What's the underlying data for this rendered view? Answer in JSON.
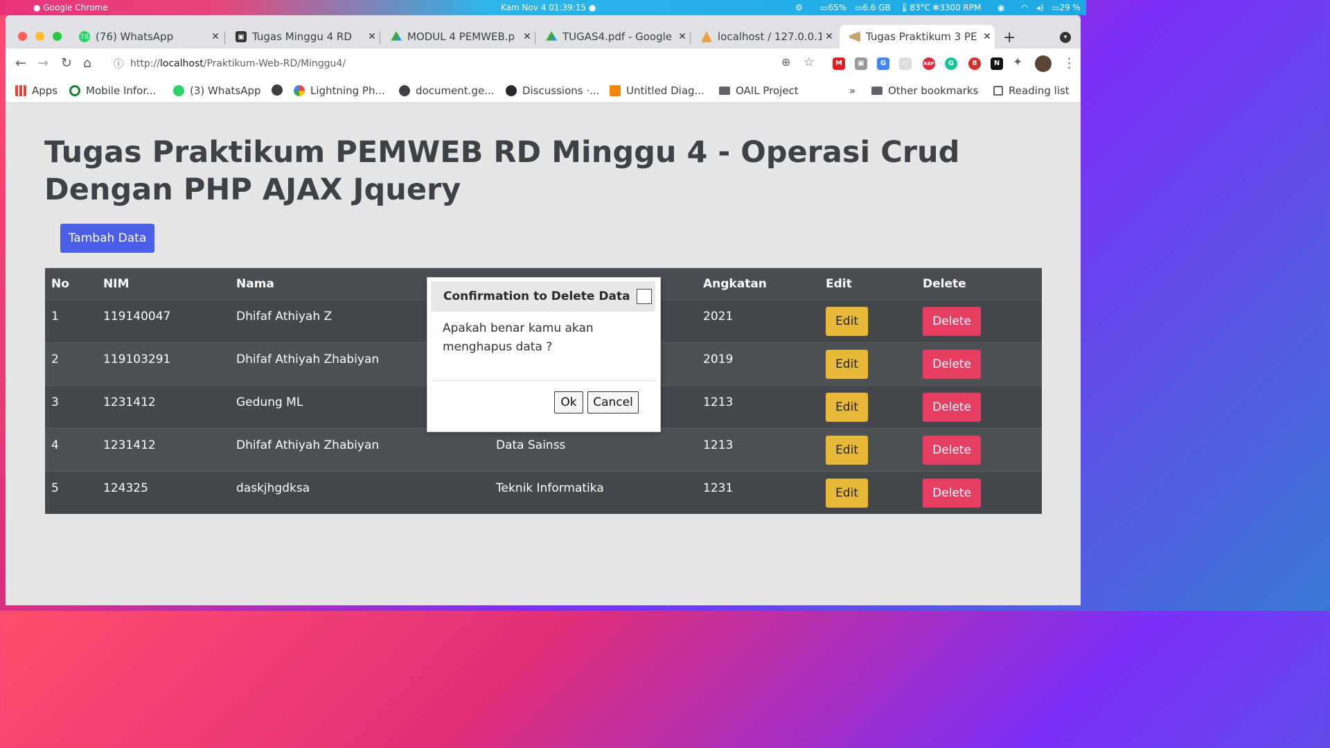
{
  "menubar": {
    "app_name": "Google Chrome",
    "clock": "Kam Nov 4  01:39:15 ●",
    "cpu": "65%",
    "mem": "6.6 GB",
    "temp": "83°C",
    "fan": "3300 RPM",
    "battery": "29 %"
  },
  "tabs": [
    {
      "label": "(76) WhatsApp",
      "icon": "whatsapp-icon"
    },
    {
      "label": "Tugas Minggu 4 RD",
      "icon": "classroom-icon"
    },
    {
      "label": "MODUL 4 PEMWEB.p",
      "icon": "drive-icon"
    },
    {
      "label": "TUGAS4.pdf - Google",
      "icon": "drive-icon"
    },
    {
      "label": "localhost / 127.0.0.1",
      "icon": "phpmyadmin-icon"
    },
    {
      "label": "Tugas Praktikum 3 PE",
      "icon": "page-icon",
      "active": true
    }
  ],
  "omnibox": {
    "url_prefix": "http://",
    "url_host": "localhost",
    "url_path": "/Praktikum-Web-RD/Minggu4/"
  },
  "bookmarks": [
    {
      "label": "Apps",
      "icon": "apps-grid-icon"
    },
    {
      "label": "Mobile Infor...",
      "icon": "bookmark-site-icon"
    },
    {
      "label": "(3) WhatsApp",
      "icon": "whatsapp-icon"
    },
    {
      "label": "Lightning Ph...",
      "icon": "google-icon"
    },
    {
      "label": "document.ge...",
      "icon": "globe-icon"
    },
    {
      "label": "Discussions ·...",
      "icon": "github-icon"
    },
    {
      "label": "Untitled Diag...",
      "icon": "drawio-icon"
    },
    {
      "label": "OAIL Project",
      "icon": "folder-icon"
    }
  ],
  "bookmarks_more": "»",
  "other_bookmarks": "Other bookmarks",
  "reading_list": "Reading list",
  "page": {
    "title": "Tugas Praktikum PEMWEB RD Minggu 4 - Operasi Crud Dengan PHP AJAX Jquery",
    "add_button": "Tambah Data",
    "table": {
      "headers": [
        "No",
        "NIM",
        "Nama",
        "",
        "Angkatan",
        "Edit",
        "Delete"
      ],
      "rows": [
        {
          "no": "1",
          "nim": "119140047",
          "nama": "Dhifaf Athiyah Z",
          "prodi": "",
          "angkatan": "2021"
        },
        {
          "no": "2",
          "nim": "119103291",
          "nama": "Dhifaf Athiyah Zhabiyan",
          "prodi": "",
          "angkatan": "2019"
        },
        {
          "no": "3",
          "nim": "1231412",
          "nama": "Gedung ML",
          "prodi": "",
          "angkatan": "1213"
        },
        {
          "no": "4",
          "nim": "1231412",
          "nama": "Dhifaf Athiyah Zhabiyan",
          "prodi": "Data Sainss",
          "angkatan": "1213"
        },
        {
          "no": "5",
          "nim": "124325",
          "nama": "daskjhgdksa",
          "prodi": "Teknik Informatika",
          "angkatan": "1231"
        }
      ],
      "edit_label": "Edit",
      "delete_label": "Delete"
    }
  },
  "modal": {
    "title": "Confirmation to Delete Data",
    "body": "Apakah benar kamu akan menghapus data ?",
    "ok": "Ok",
    "cancel": "Cancel"
  },
  "colors": {
    "primary": "#4a5ee8",
    "warning": "#e8b838",
    "danger": "#e53e62",
    "table_bg": "#4a4e53"
  }
}
